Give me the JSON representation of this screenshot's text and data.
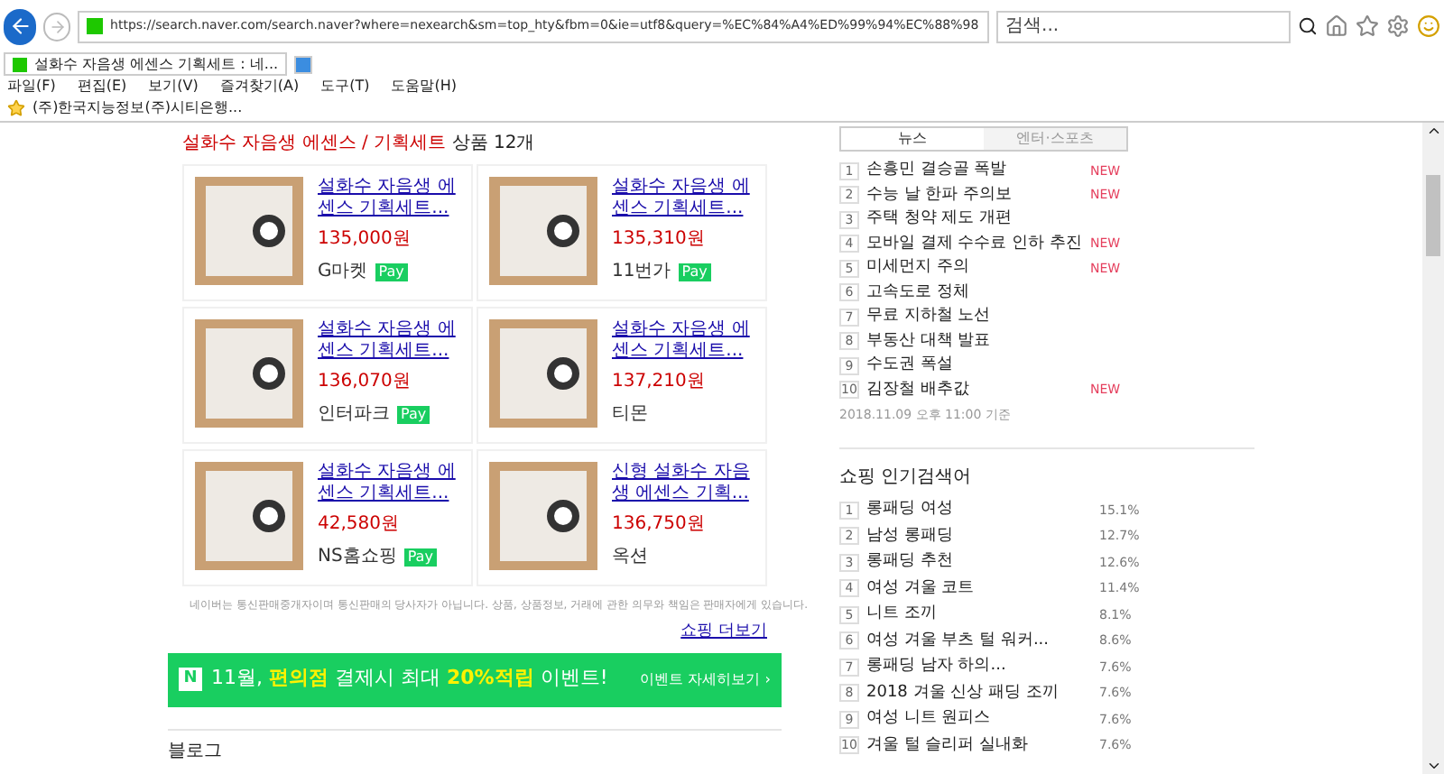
{
  "browser": {
    "url": "https://search.naver.com/search.naver?where=nexearch&sm=top_hty&fbm=0&ie=utf8&query=%EC%84%A4%ED%99%94%EC%88%98",
    "search_placeholder": "검색...",
    "tabs": [
      {
        "label": "설화수 자음생 에센스 기획세트 : 네...",
        "selected": true
      }
    ],
    "menu": [
      "파일(F)",
      "편집(E)",
      "보기(V)",
      "즐겨찾기(A)",
      "도구(T)",
      "도움말(H)"
    ],
    "favorites": [
      "(주)한국지능정보(주)시티은행..."
    ]
  },
  "shopping": {
    "heading_highlight": "설화수 자음생 에센스 / 기획세트",
    "heading_rest": "상품 12개",
    "products": [
      {
        "title": "설화수 자음생 에센스 기획세트...",
        "price": "135,000원",
        "store": "G마켓",
        "badge": "Pay"
      },
      {
        "title": "설화수 자음생 에센스 기획세트...",
        "price": "135,310원",
        "store": "11번가",
        "badge": "Pay"
      },
      {
        "title": "설화수 자음생 에센스 기획세트...",
        "price": "136,070원",
        "store": "인터파크",
        "badge": "Pay"
      },
      {
        "title": "설화수 자음생 에센스 기획세트...",
        "price": "137,210원",
        "store": "티몬"
      },
      {
        "title": "설화수 자음생 에센스 기획세트...",
        "price": "42,580원",
        "store": "NS홈쇼핑",
        "badge": "Pay"
      },
      {
        "title": "신형 설화수 자음생 에센스 기획...",
        "price": "136,750원",
        "store": "옥션"
      }
    ],
    "notice": "네이버는 통신판매중개자이며 통신판매의 당사자가 아닙니다. 상품, 상품정보, 거래에 관한 의무와 책임은 판매자에게 있습니다.",
    "more_link": "쇼핑 더보기",
    "banner": {
      "logo": "N",
      "text": "11월, **편의점** 결제시 최대 **20%적립** 이벤트!",
      "link": "이벤트 자세히보기 ›"
    },
    "next_section": "블로그"
  },
  "news": {
    "tabs": [
      {
        "label": "뉴스",
        "selected": true
      },
      {
        "label": "엔터·스포츠",
        "selected": false
      }
    ],
    "items": [
      {
        "rank": "1",
        "title": "손흥민 결승골 폭발",
        "tag": "NEW"
      },
      {
        "rank": "2",
        "title": "수능 날 한파 주의보",
        "tag": "NEW"
      },
      {
        "rank": "3",
        "title": "주택 청약 제도 개편"
      },
      {
        "rank": "4",
        "title": "모바일 결제 수수료 인하 추진",
        "tag": "NEW"
      },
      {
        "rank": "5",
        "title": "미세먼지 주의",
        "tag": "NEW"
      },
      {
        "rank": "6",
        "title": "고속도로 정체"
      },
      {
        "rank": "7",
        "title": "무료 지하철 노선"
      },
      {
        "rank": "8",
        "title": "부동산 대책 발표"
      },
      {
        "rank": "9",
        "title": "수도권 폭설"
      },
      {
        "rank": "10",
        "title": "김장철 배추값",
        "tag": "NEW"
      }
    ],
    "footer": "2018.11.09 오후 11:00 기준"
  },
  "shopping_trends": {
    "title": "쇼핑 인기검색어",
    "items": [
      {
        "rank": "1",
        "title": "롱패딩 여성",
        "share": "15.1%"
      },
      {
        "rank": "2",
        "title": "남성 롱패딩",
        "share": "12.7%"
      },
      {
        "rank": "3",
        "title": "롱패딩 추천",
        "share": "12.6%"
      },
      {
        "rank": "4",
        "title": "여성 겨울 코트",
        "share": "11.4%"
      },
      {
        "rank": "5",
        "title": "니트 조끼",
        "share": "8.1%"
      },
      {
        "rank": "6",
        "title": "여성 겨울 부츠 털 워커...",
        "share": "8.6%"
      },
      {
        "rank": "7",
        "title": "롱패딩 남자 하의...",
        "share": "7.6%"
      },
      {
        "rank": "8",
        "title": "2018 겨울 신상 패딩 조끼",
        "share": "7.6%"
      },
      {
        "rank": "9",
        "title": "여성 니트 원피스",
        "share": "7.6%"
      },
      {
        "rank": "10",
        "title": "겨울 털 슬리퍼 실내화",
        "share": "7.6%"
      }
    ]
  }
}
